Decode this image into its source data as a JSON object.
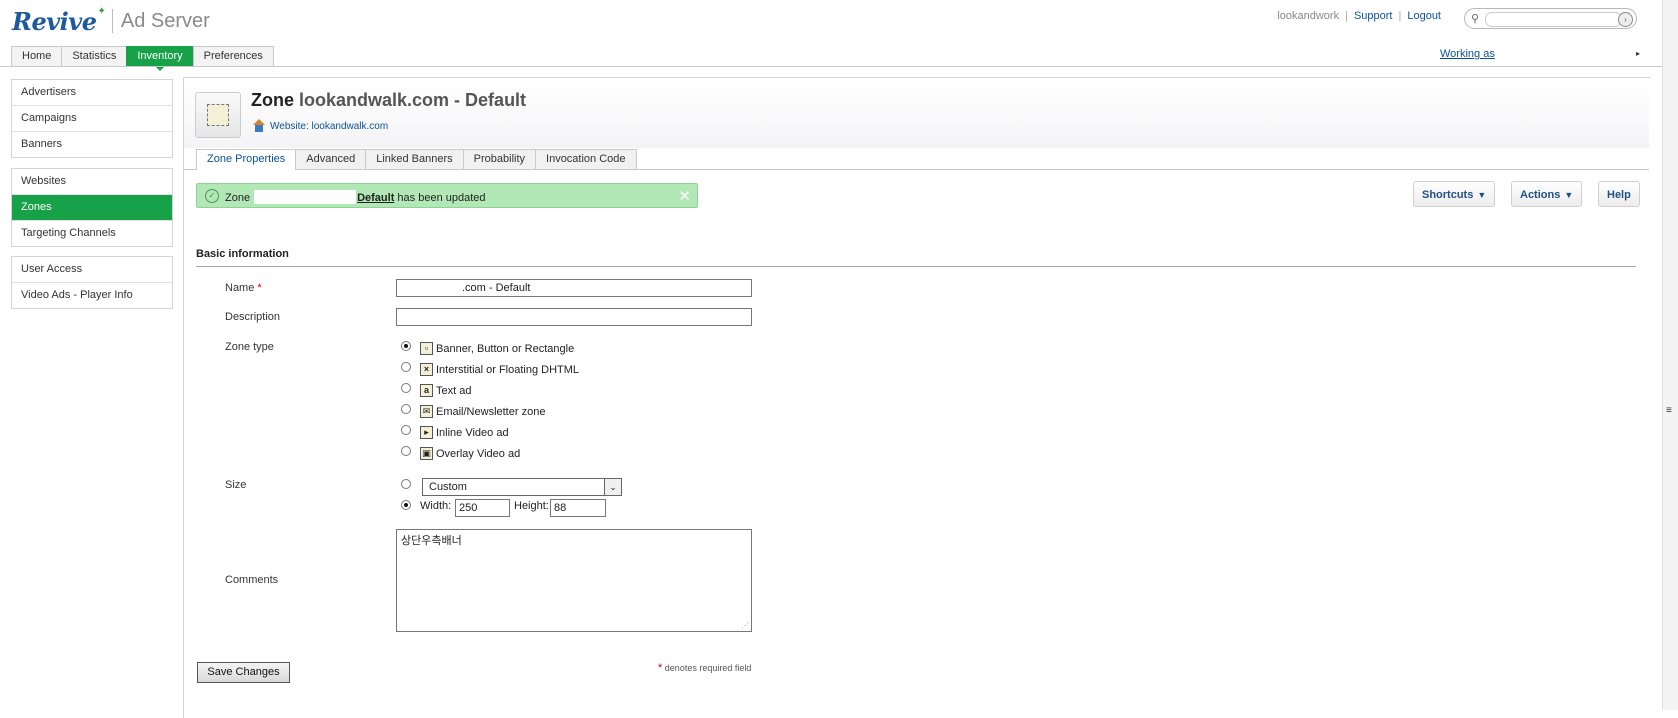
{
  "header": {
    "brand": "Revive",
    "product": "Ad Server",
    "user": "lookandwork",
    "support_label": "Support",
    "logout_label": "Logout",
    "separator": "|",
    "working_as_label": "Working as"
  },
  "main_tabs": [
    {
      "label": "Home"
    },
    {
      "label": "Statistics"
    },
    {
      "label": "Inventory"
    },
    {
      "label": "Preferences"
    }
  ],
  "sidebar": {
    "group1": [
      {
        "label": "Advertisers"
      },
      {
        "label": "Campaigns"
      },
      {
        "label": "Banners"
      }
    ],
    "group2": [
      {
        "label": "Websites"
      },
      {
        "label": "Zones"
      },
      {
        "label": "Targeting Channels"
      }
    ],
    "group3": [
      {
        "label": "User Access"
      },
      {
        "label": "Video Ads - Player Info"
      }
    ]
  },
  "zone": {
    "title_prefix": "Zone",
    "title_name": "lookandwalk.com - Default",
    "website_link": "Website: lookandwalk.com"
  },
  "sub_tabs": [
    {
      "label": "Zone Properties"
    },
    {
      "label": "Advanced"
    },
    {
      "label": "Linked Banners"
    },
    {
      "label": "Probability"
    },
    {
      "label": "Invocation Code"
    }
  ],
  "notice": {
    "prefix": "Zone",
    "zone_link": "Default",
    "suffix": "has been updated"
  },
  "toolbar": {
    "shortcuts_label": "Shortcuts",
    "actions_label": "Actions",
    "help_label": "Help"
  },
  "form": {
    "section_title": "Basic information",
    "name_label": "Name",
    "required_mark": "*",
    "name_value": ".com - Default",
    "description_label": "Description",
    "description_value": "",
    "zone_type_label": "Zone type",
    "zone_types": [
      {
        "label": "Banner, Button or Rectangle",
        "icon": "banner-icon",
        "selected": true
      },
      {
        "label": "Interstitial or Floating DHTML",
        "icon": "interstitial-icon",
        "selected": false
      },
      {
        "label": "Text ad",
        "icon": "text-ad-icon",
        "selected": false
      },
      {
        "label": "Email/Newsletter zone",
        "icon": "email-icon",
        "selected": false
      },
      {
        "label": "Inline Video ad",
        "icon": "inline-video-icon",
        "selected": false
      },
      {
        "label": "Overlay Video ad",
        "icon": "overlay-video-icon",
        "selected": false
      }
    ],
    "size_label": "Size",
    "size_select_value": "Custom",
    "width_label": "Width:",
    "width_value": "250",
    "height_label": "Height:",
    "height_value": "88",
    "comments_label": "Comments",
    "comments_value": "상단우측배너",
    "save_label": "Save Changes",
    "required_note": "denotes required field"
  },
  "colors": {
    "accent_green": "#17a24a",
    "link_blue": "#0b5394",
    "notice_green": "#b2e8b6"
  }
}
